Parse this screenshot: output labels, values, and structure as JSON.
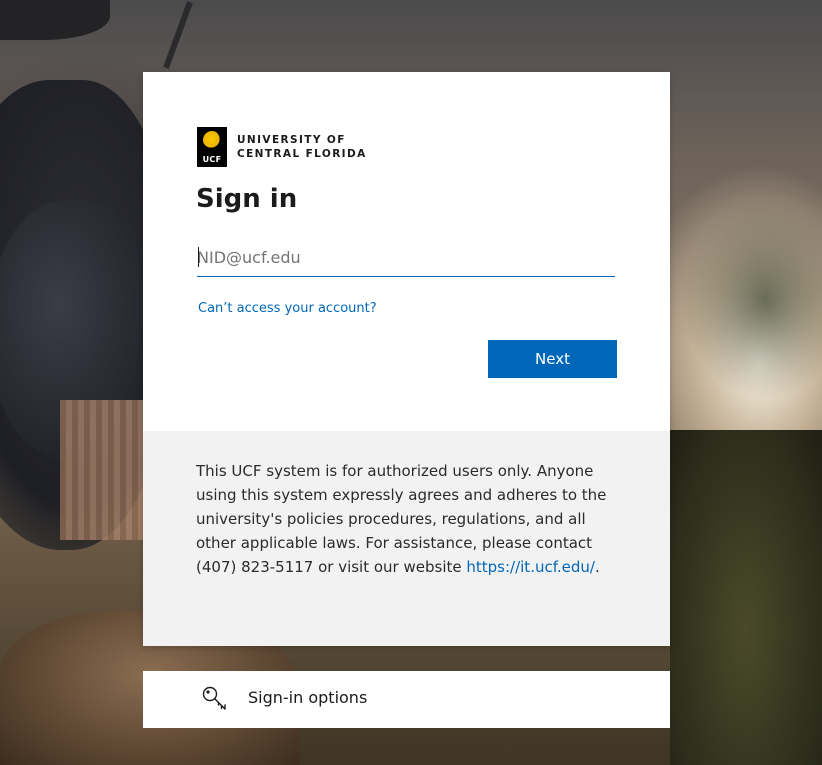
{
  "logo": {
    "mark_text": "UCF",
    "line1": "UNIVERSITY OF",
    "line2": "CENTRAL FLORIDA"
  },
  "signin": {
    "title": "Sign in",
    "input_placeholder": "NID@ucf.edu",
    "input_value": "",
    "cant_access_link": "Can’t access your account?",
    "next_button": "Next"
  },
  "notice": {
    "text": "This UCF system is for authorized users only. Anyone using this system expressly agrees and adheres to the university's policies procedures, regulations, and all other applicable laws. For assistance, please contact (407) 823-5117 or visit our website ",
    "link_text": "https://it.ucf.edu/",
    "trailing": "."
  },
  "options": {
    "label": "Sign-in options",
    "icon": "key-icon"
  },
  "colors": {
    "accent": "#0067b8",
    "notice_bg": "#f2f2f2",
    "ucf_gold": "#ffc904"
  }
}
